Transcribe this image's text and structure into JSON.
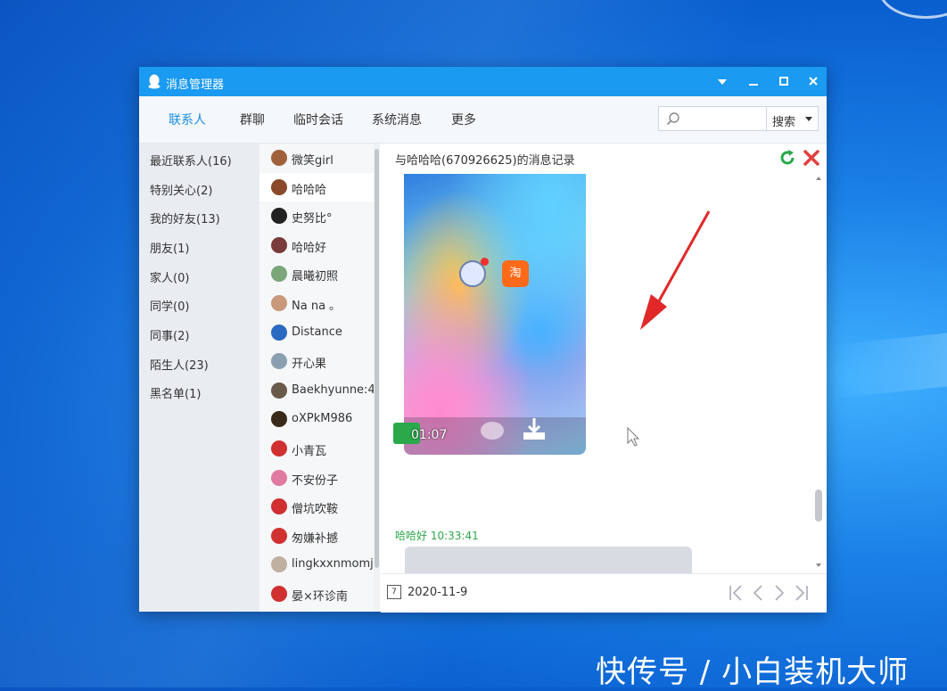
{
  "window": {
    "title": "消息管理器",
    "controls": [
      "menu-caret",
      "minimize",
      "maximize",
      "close"
    ]
  },
  "nav": {
    "tabs": [
      "联系人",
      "群聊",
      "临时会话",
      "系统消息",
      "更多"
    ],
    "active_tab": "联系人",
    "search_placeholder": "",
    "search_button": "搜索"
  },
  "groups": [
    "最近联系人(16)",
    "特别关心(2)",
    "我的好友(13)",
    "朋友(1)",
    "家人(0)",
    "同学(0)",
    "同事(2)",
    "陌生人(23)",
    "黑名单(1)"
  ],
  "contacts": [
    {
      "name": "微笑girl",
      "color": "#a0603a"
    },
    {
      "name": "哈哈哈",
      "color": "#8a4a2a",
      "selected": true
    },
    {
      "name": "史努比°",
      "color": "#222222"
    },
    {
      "name": "哈哈好",
      "color": "#7a3b3b"
    },
    {
      "name": "晨曦初照",
      "color": "#7aa67a"
    },
    {
      "name": "Na na ｡",
      "color": "#c9987a"
    },
    {
      "name": "Distance",
      "color": "#2a6ac0"
    },
    {
      "name": "开心果",
      "color": "#8aa0b0"
    },
    {
      "name": "Baekhyunne:4",
      "color": "#6a5a4a"
    },
    {
      "name": "oXPkM986",
      "color": "#3a2a1a"
    },
    {
      "name": "小青瓦",
      "color": "#d03030"
    },
    {
      "name": "不安份子",
      "color": "#e07aa0"
    },
    {
      "name": "僧坑吹鞍",
      "color": "#d03030"
    },
    {
      "name": "匆嫌补撼",
      "color": "#d03030"
    },
    {
      "name": "lingkxxnmomj",
      "color": "#c0b0a0"
    },
    {
      "name": "晏×环诊南",
      "color": "#d03030"
    }
  ],
  "chat": {
    "header": "与哈哈哈(670926625)的消息记录",
    "video_time": "01:07",
    "phone_app_label": "淘",
    "sender": "哈哈好",
    "sender_time": "10:33:41"
  },
  "footer": {
    "date": "2020-11-9",
    "calendar_icon_label": "7"
  },
  "watermark": "快传号 / 小白装机大师",
  "colors": {
    "titlebar": "#1a9af0",
    "accent": "#1a8de6",
    "sender_green": "#2aa84a",
    "arrow_red": "#e02828"
  }
}
